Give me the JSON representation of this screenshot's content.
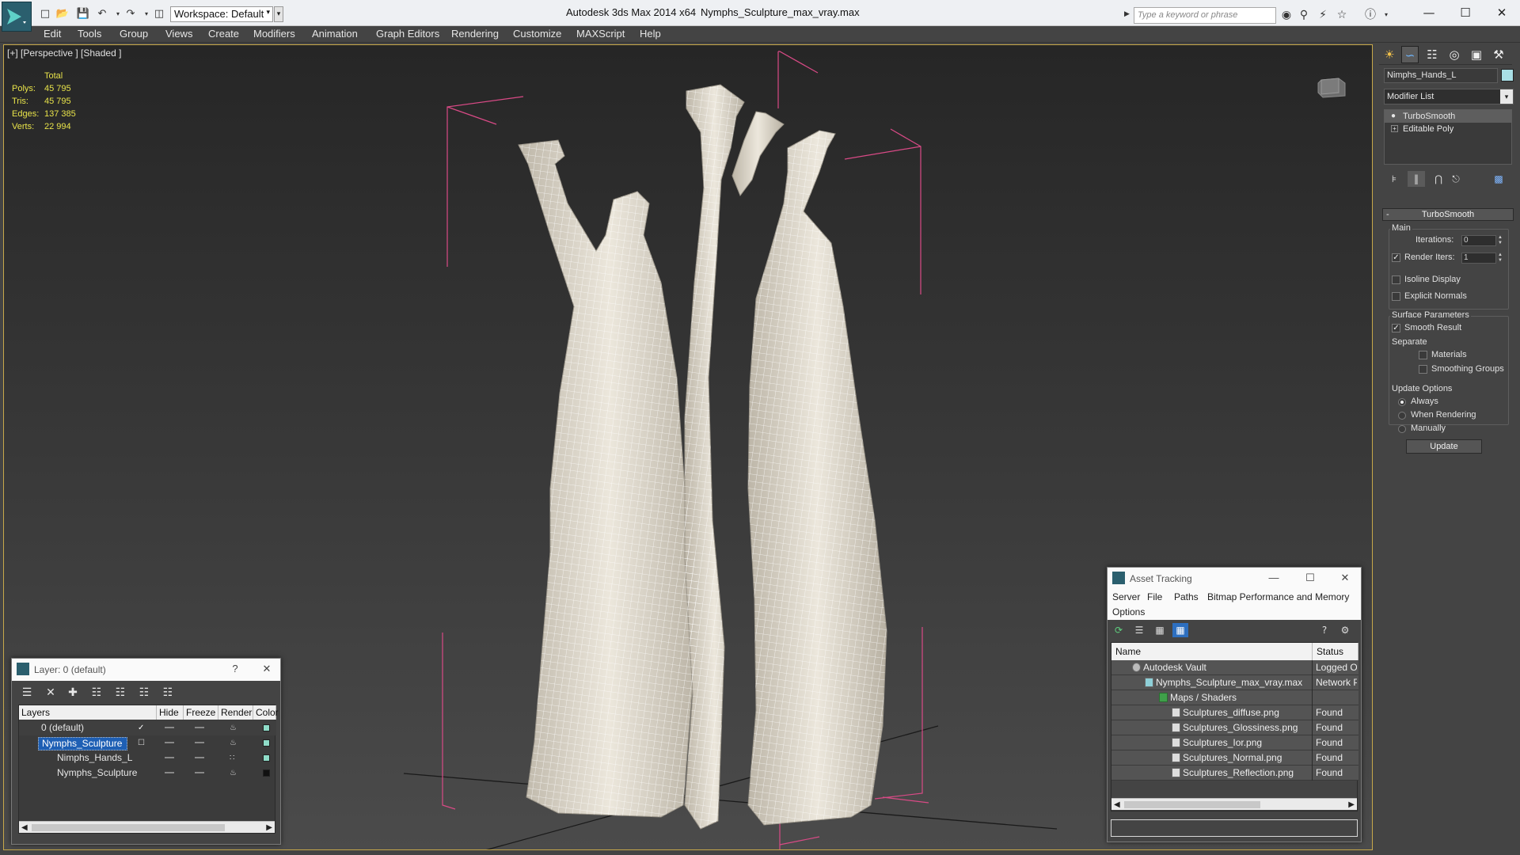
{
  "titlebar": {
    "workspace": "Workspace: Default",
    "app_name": "Autodesk 3ds Max  2014 x64",
    "file_name": "Nymphs_Sculpture_max_vray.max",
    "search_placeholder": "Type a keyword or phrase"
  },
  "menu": {
    "items": [
      "Edit",
      "Tools",
      "Group",
      "Views",
      "Create",
      "Modifiers",
      "Animation",
      "Graph Editors",
      "Rendering",
      "Customize",
      "MAXScript",
      "Help"
    ]
  },
  "viewport": {
    "label": "[+] [Perspective ] [Shaded ]",
    "stats": {
      "total_label": "Total",
      "polys_label": "Polys:",
      "polys": "45 795",
      "tris_label": "Tris:",
      "tris": "45 795",
      "edges_label": "Edges:",
      "edges": "137 385",
      "verts_label": "Verts:",
      "verts": "22 994"
    },
    "colors": {
      "bbox": "#d94a86",
      "mesh": "#ece7dc",
      "wire": "#ffffff",
      "border": "#c7a84a"
    }
  },
  "command_panel": {
    "object_name": "Nimphs_Hands_L",
    "object_color": "#a9dfe6",
    "modifier_list": "Modifier List",
    "stack": [
      "TurboSmooth",
      "Editable Poly"
    ],
    "rollout": "TurboSmooth",
    "main_group": "Main",
    "iterations_label": "Iterations:",
    "iterations": "0",
    "render_iters_label": "Render Iters:",
    "render_iters": "1",
    "isoline_display": "Isoline Display",
    "explicit_normals": "Explicit Normals",
    "surface_group": "Surface Parameters",
    "smooth_result": "Smooth Result",
    "separate_label": "Separate",
    "materials": "Materials",
    "smoothing_groups": "Smoothing Groups",
    "update_group": "Update Options",
    "always": "Always",
    "when_rendering": "When Rendering",
    "manually": "Manually",
    "update_button": "Update"
  },
  "layer_dialog": {
    "title": "Layer: 0 (default)",
    "help": "?",
    "columns": [
      "Layers",
      "Hide",
      "Freeze",
      "Render",
      "Color"
    ],
    "rows": [
      {
        "name": "0 (default)",
        "color": "#8fdcc8"
      },
      {
        "name": "Nymphs_Sculpture",
        "color": "#8fdcc8"
      },
      {
        "name": "Nimphs_Hands_L",
        "color": "#8fdcc8"
      },
      {
        "name": "Nymphs_Sculpture",
        "color": "#111111"
      }
    ]
  },
  "asset_dialog": {
    "title": "Asset Tracking",
    "menu": [
      "Server",
      "File",
      "Paths",
      "Bitmap Performance and Memory",
      "Options"
    ],
    "columns": [
      "Name",
      "Status"
    ],
    "rows": [
      {
        "name": "Autodesk Vault",
        "status": "Logged Out"
      },
      {
        "name": "Nymphs_Sculpture_max_vray.max",
        "status": "Network Path"
      },
      {
        "name": "Maps / Shaders",
        "status": ""
      },
      {
        "name": "Sculptures_diffuse.png",
        "status": "Found"
      },
      {
        "name": "Sculptures_Glossiness.png",
        "status": "Found"
      },
      {
        "name": "Sculptures_Ior.png",
        "status": "Found"
      },
      {
        "name": "Sculptures_Normal.png",
        "status": "Found"
      },
      {
        "name": "Sculptures_Reflection.png",
        "status": "Found"
      }
    ]
  }
}
